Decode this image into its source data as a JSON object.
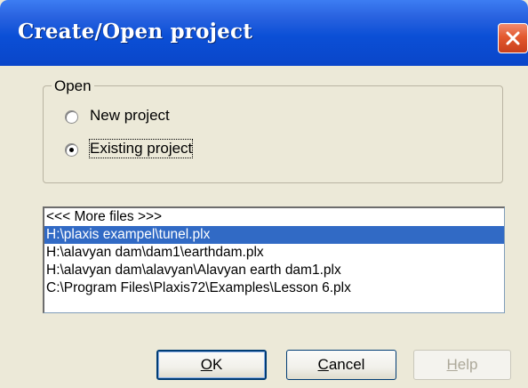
{
  "window": {
    "title": "Create/Open project",
    "close_icon": "close-icon"
  },
  "open_group": {
    "legend": "Open",
    "options": [
      {
        "label": "New project",
        "selected": false
      },
      {
        "label": "Existing project",
        "selected": true
      }
    ]
  },
  "file_list": {
    "items": [
      "<<< More files >>>",
      "H:\\plaxis exampel\\tunel.plx",
      "H:\\alavyan dam\\dam1\\earthdam.plx",
      "H:\\alavyan dam\\alavyan\\Alavyan earth dam1.plx",
      "C:\\Program Files\\Plaxis72\\Examples\\Lesson 6.plx"
    ],
    "selected_index": 1
  },
  "buttons": {
    "ok_mnemonic": "O",
    "ok_rest": "K",
    "cancel_mnemonic": "C",
    "cancel_rest": "ancel",
    "help_mnemonic": "H",
    "help_rest": "elp"
  },
  "colors": {
    "title_bar": "#0a46c9",
    "selection": "#316ac5",
    "dialog_bg": "#ece9d8",
    "close_button": "#e3592f"
  }
}
